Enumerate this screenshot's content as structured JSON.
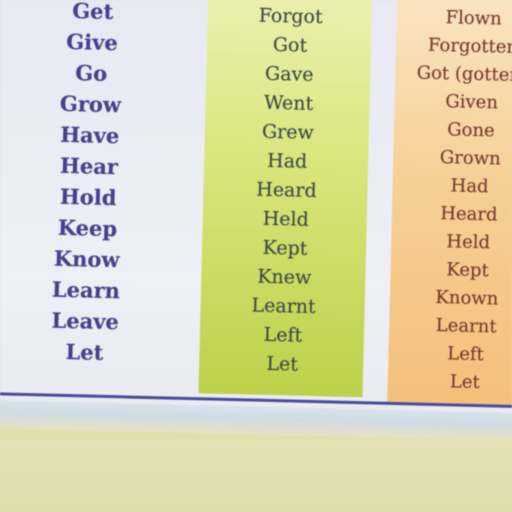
{
  "columns": {
    "base_form": [
      "Get",
      "Give",
      "Go",
      "Grow",
      "Have",
      "Hear",
      "Hold",
      "Keep",
      "Know",
      "Learn",
      "Leave",
      "Let"
    ],
    "past_simple": [
      "Forgot",
      "Got",
      "Gave",
      "Went",
      "Grew",
      "Had",
      "Heard",
      "Held",
      "Kept",
      "Knew",
      "Learnt",
      "Left",
      "Let"
    ],
    "past_participle": [
      "Flown",
      "Forgotten",
      "Got (gotten)",
      "Given",
      "Gone",
      "Grown",
      "Had",
      "Heard",
      "Held",
      "Kept",
      "Known",
      "Learnt",
      "Left",
      "Let"
    ]
  },
  "colors": {
    "base_form_text": "#4a3f8f",
    "past_simple_background": "#cfe05e",
    "past_participle_background": "#f6c787",
    "accent_line": "#4a4c9a"
  }
}
